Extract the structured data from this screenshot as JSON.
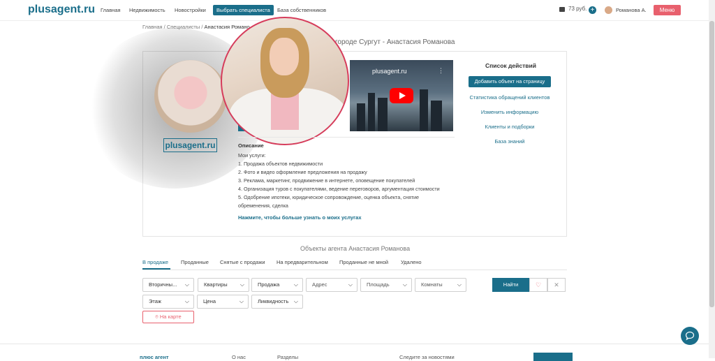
{
  "header": {
    "logo": "plusagent.ru",
    "nav": [
      "Главная",
      "Недвижимость",
      "Новостройки"
    ],
    "nav_active": "Выбрать специалиста",
    "nav_last": "База собственников",
    "balance": "73 руб.",
    "plus": "+",
    "user_name": "Романова А.",
    "menu": "Меню"
  },
  "breadcrumb": {
    "items": [
      "Главная",
      "Специалисты"
    ],
    "current": "Анастасия Романо"
  },
  "page_title": "городе Сургут - Анастасия Романова",
  "profile": {
    "logo_text": "plusagent.ru"
  },
  "video": {
    "title": "plusagent.ru",
    "menu": "⋮"
  },
  "description": {
    "title": "Описание",
    "lines": [
      "Мои услуги:",
      "1. Продажа объектов недвижимости",
      "2. Фото и видео оформление предложения на продажу",
      "3. Реклама, маркетинг, продвижение в интернете, оповещение покупателей",
      "4. Организация туров с покупателями, ведение  переговоров, аргументация стоимости",
      "5. Одобрение ипотеки, юридическое сопровождение, оценка объекта, снятие",
      "обременения, сделка"
    ],
    "link": "Нажмите, чтобы больше узнать о моих услугах"
  },
  "actions": {
    "title": "Список действий",
    "button": "Добавить объект на страницу",
    "links": [
      "Статистика обращений клиентов",
      "Изменить информацию",
      "Клиенты и подборки",
      "База знаний"
    ]
  },
  "objects": {
    "title": "Объекты агента Анастасия Романова",
    "tabs": [
      "В продаже",
      "Проданные",
      "Снятые с продажи",
      "На предварительном",
      "Проданные не мной",
      "Удалено"
    ]
  },
  "filters": {
    "row1": [
      "Вторичны...",
      "Квартиры",
      "Продажа",
      "Адрес",
      "Площадь",
      "Комнаты"
    ],
    "row2": [
      "Этаж",
      "Цена",
      "Ликвидность"
    ],
    "find": "Найти",
    "heart": "♡",
    "clear": "✕",
    "map": "На карте",
    "chevron": "⌵"
  },
  "footer": {
    "texts": [
      "плюс агент",
      "О нас",
      "Разделы",
      "Следите за новостями"
    ]
  },
  "chat_icon": "chat-bubble-icon"
}
